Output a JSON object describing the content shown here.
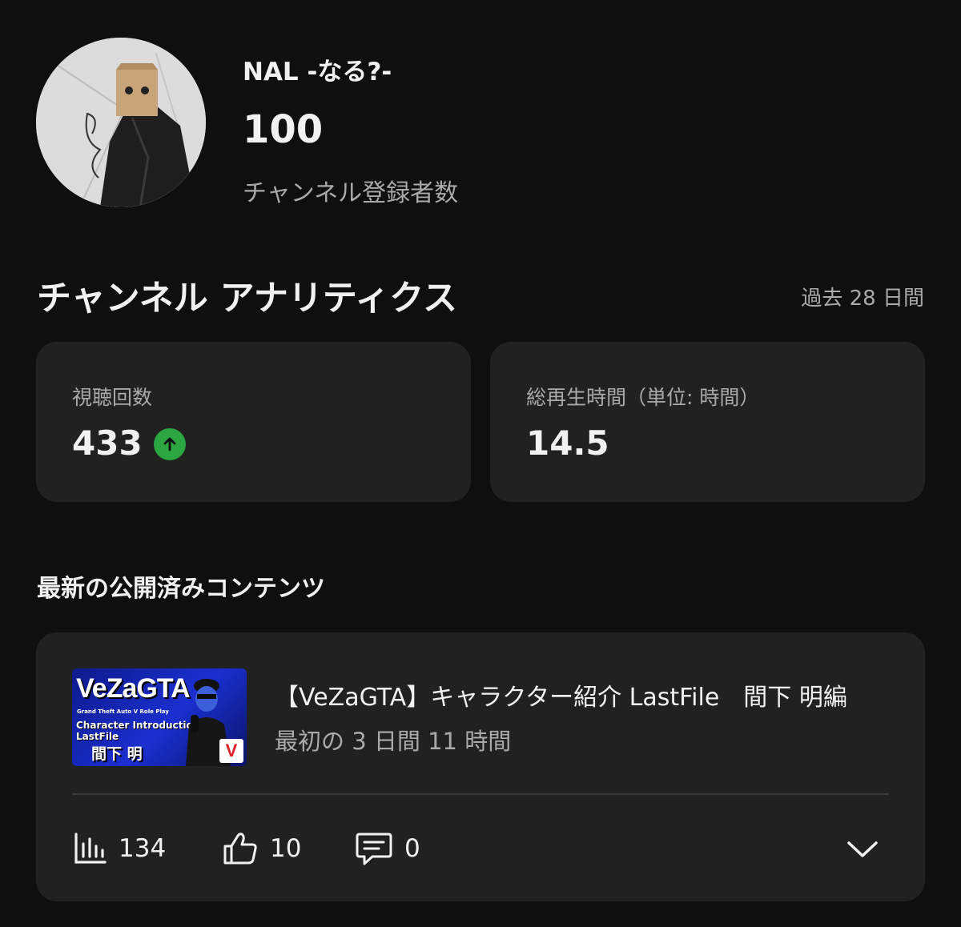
{
  "channel": {
    "name": "NAL -なる?-",
    "subscriber_count": "100",
    "subscriber_label": "チャンネル登録者数"
  },
  "analytics": {
    "title": "チャンネル アナリティクス",
    "period": "過去 28 日間",
    "cards": [
      {
        "label": "視聴回数",
        "value": "433",
        "trend": "up",
        "trend_color": "#2ba640"
      },
      {
        "label": "総再生時間（単位: 時間）",
        "value": "14.5"
      }
    ]
  },
  "latest": {
    "section_title": "最新の公開済みコンテンツ",
    "video": {
      "title": "【VeZaGTA】キャラクター紹介 LastFile　間下 明編",
      "subtitle": "最初の 3 日間 11 時間",
      "thumbnail": {
        "logo_text": "VeZaGTA",
        "line1": "Grand Theft Auto V  Role Play",
        "line2": "Character Introduction",
        "line3": "LastFile",
        "name": "間下 明",
        "badge": "V"
      },
      "stats": {
        "views": "134",
        "likes": "10",
        "comments": "0"
      }
    }
  },
  "icons": [
    "bar-chart-icon",
    "thumbs-up-icon",
    "comment-icon",
    "chevron-down-icon",
    "arrow-up-icon"
  ]
}
